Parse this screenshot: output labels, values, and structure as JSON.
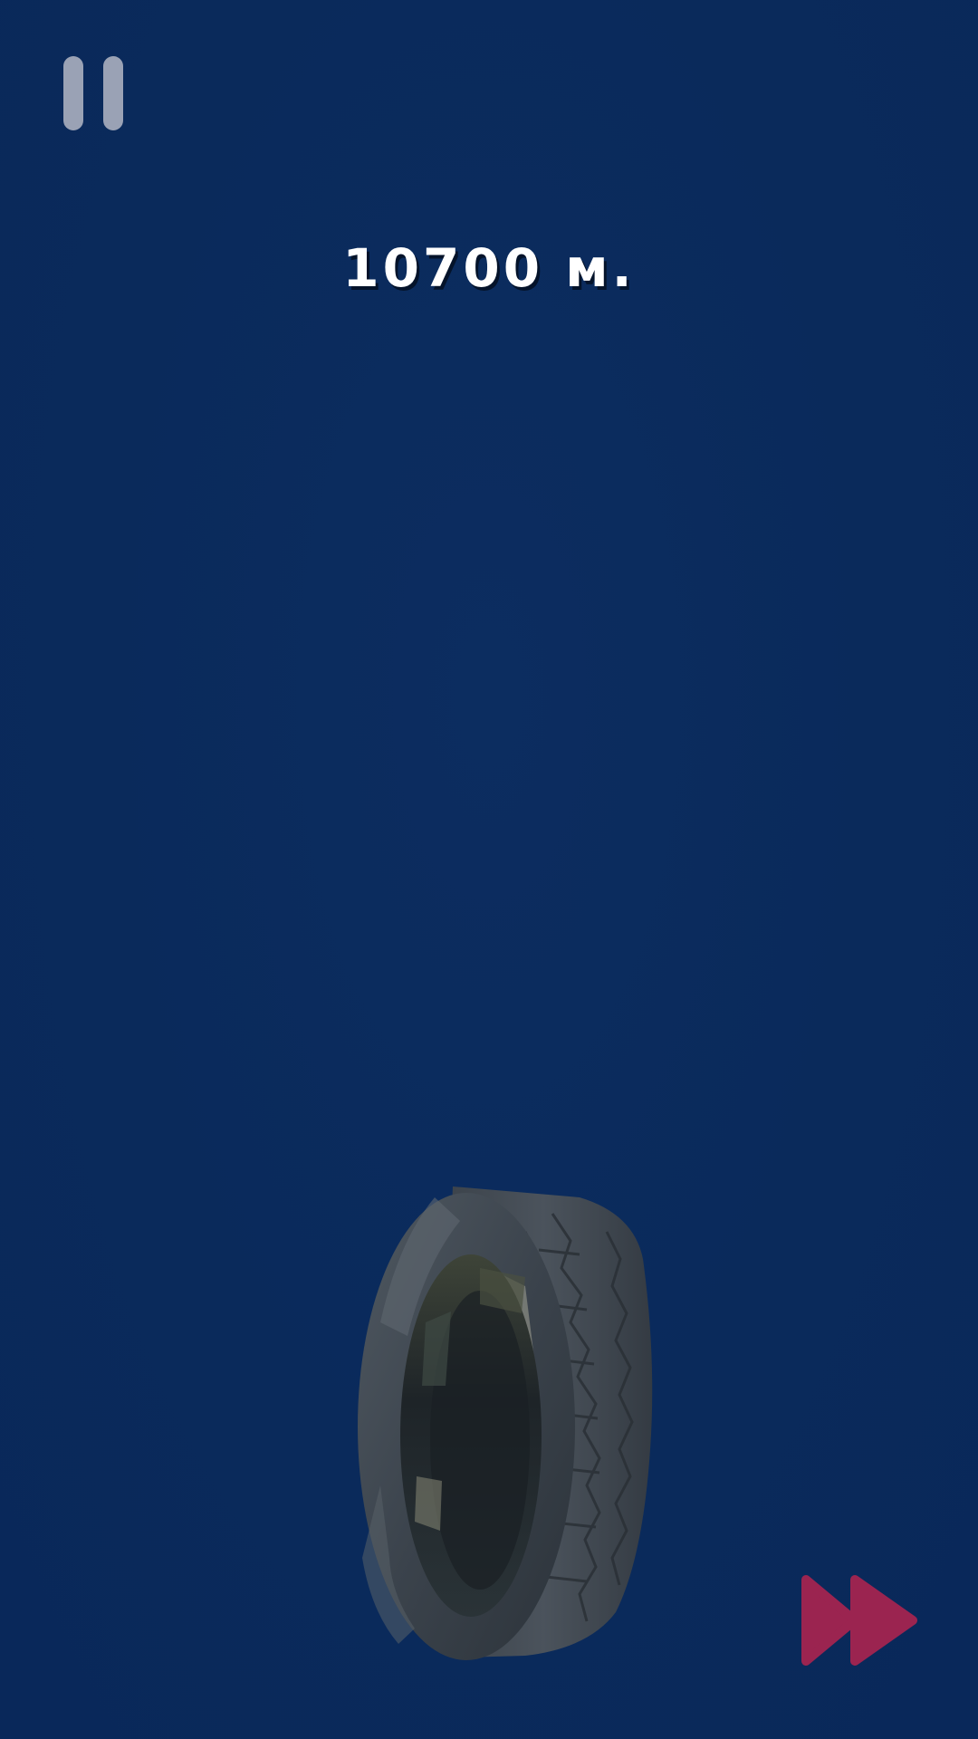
{
  "hud": {
    "distance_text": "10700 м."
  },
  "icons": {
    "pause": "pause-icon",
    "fast_forward": "fast-forward-icon",
    "player": "tire"
  },
  "colors": {
    "background": "#0b2a5c",
    "pause_icon": "#9aa2b5",
    "fast_forward_icon": "#9b2450",
    "distance_text": "#ffffff"
  }
}
